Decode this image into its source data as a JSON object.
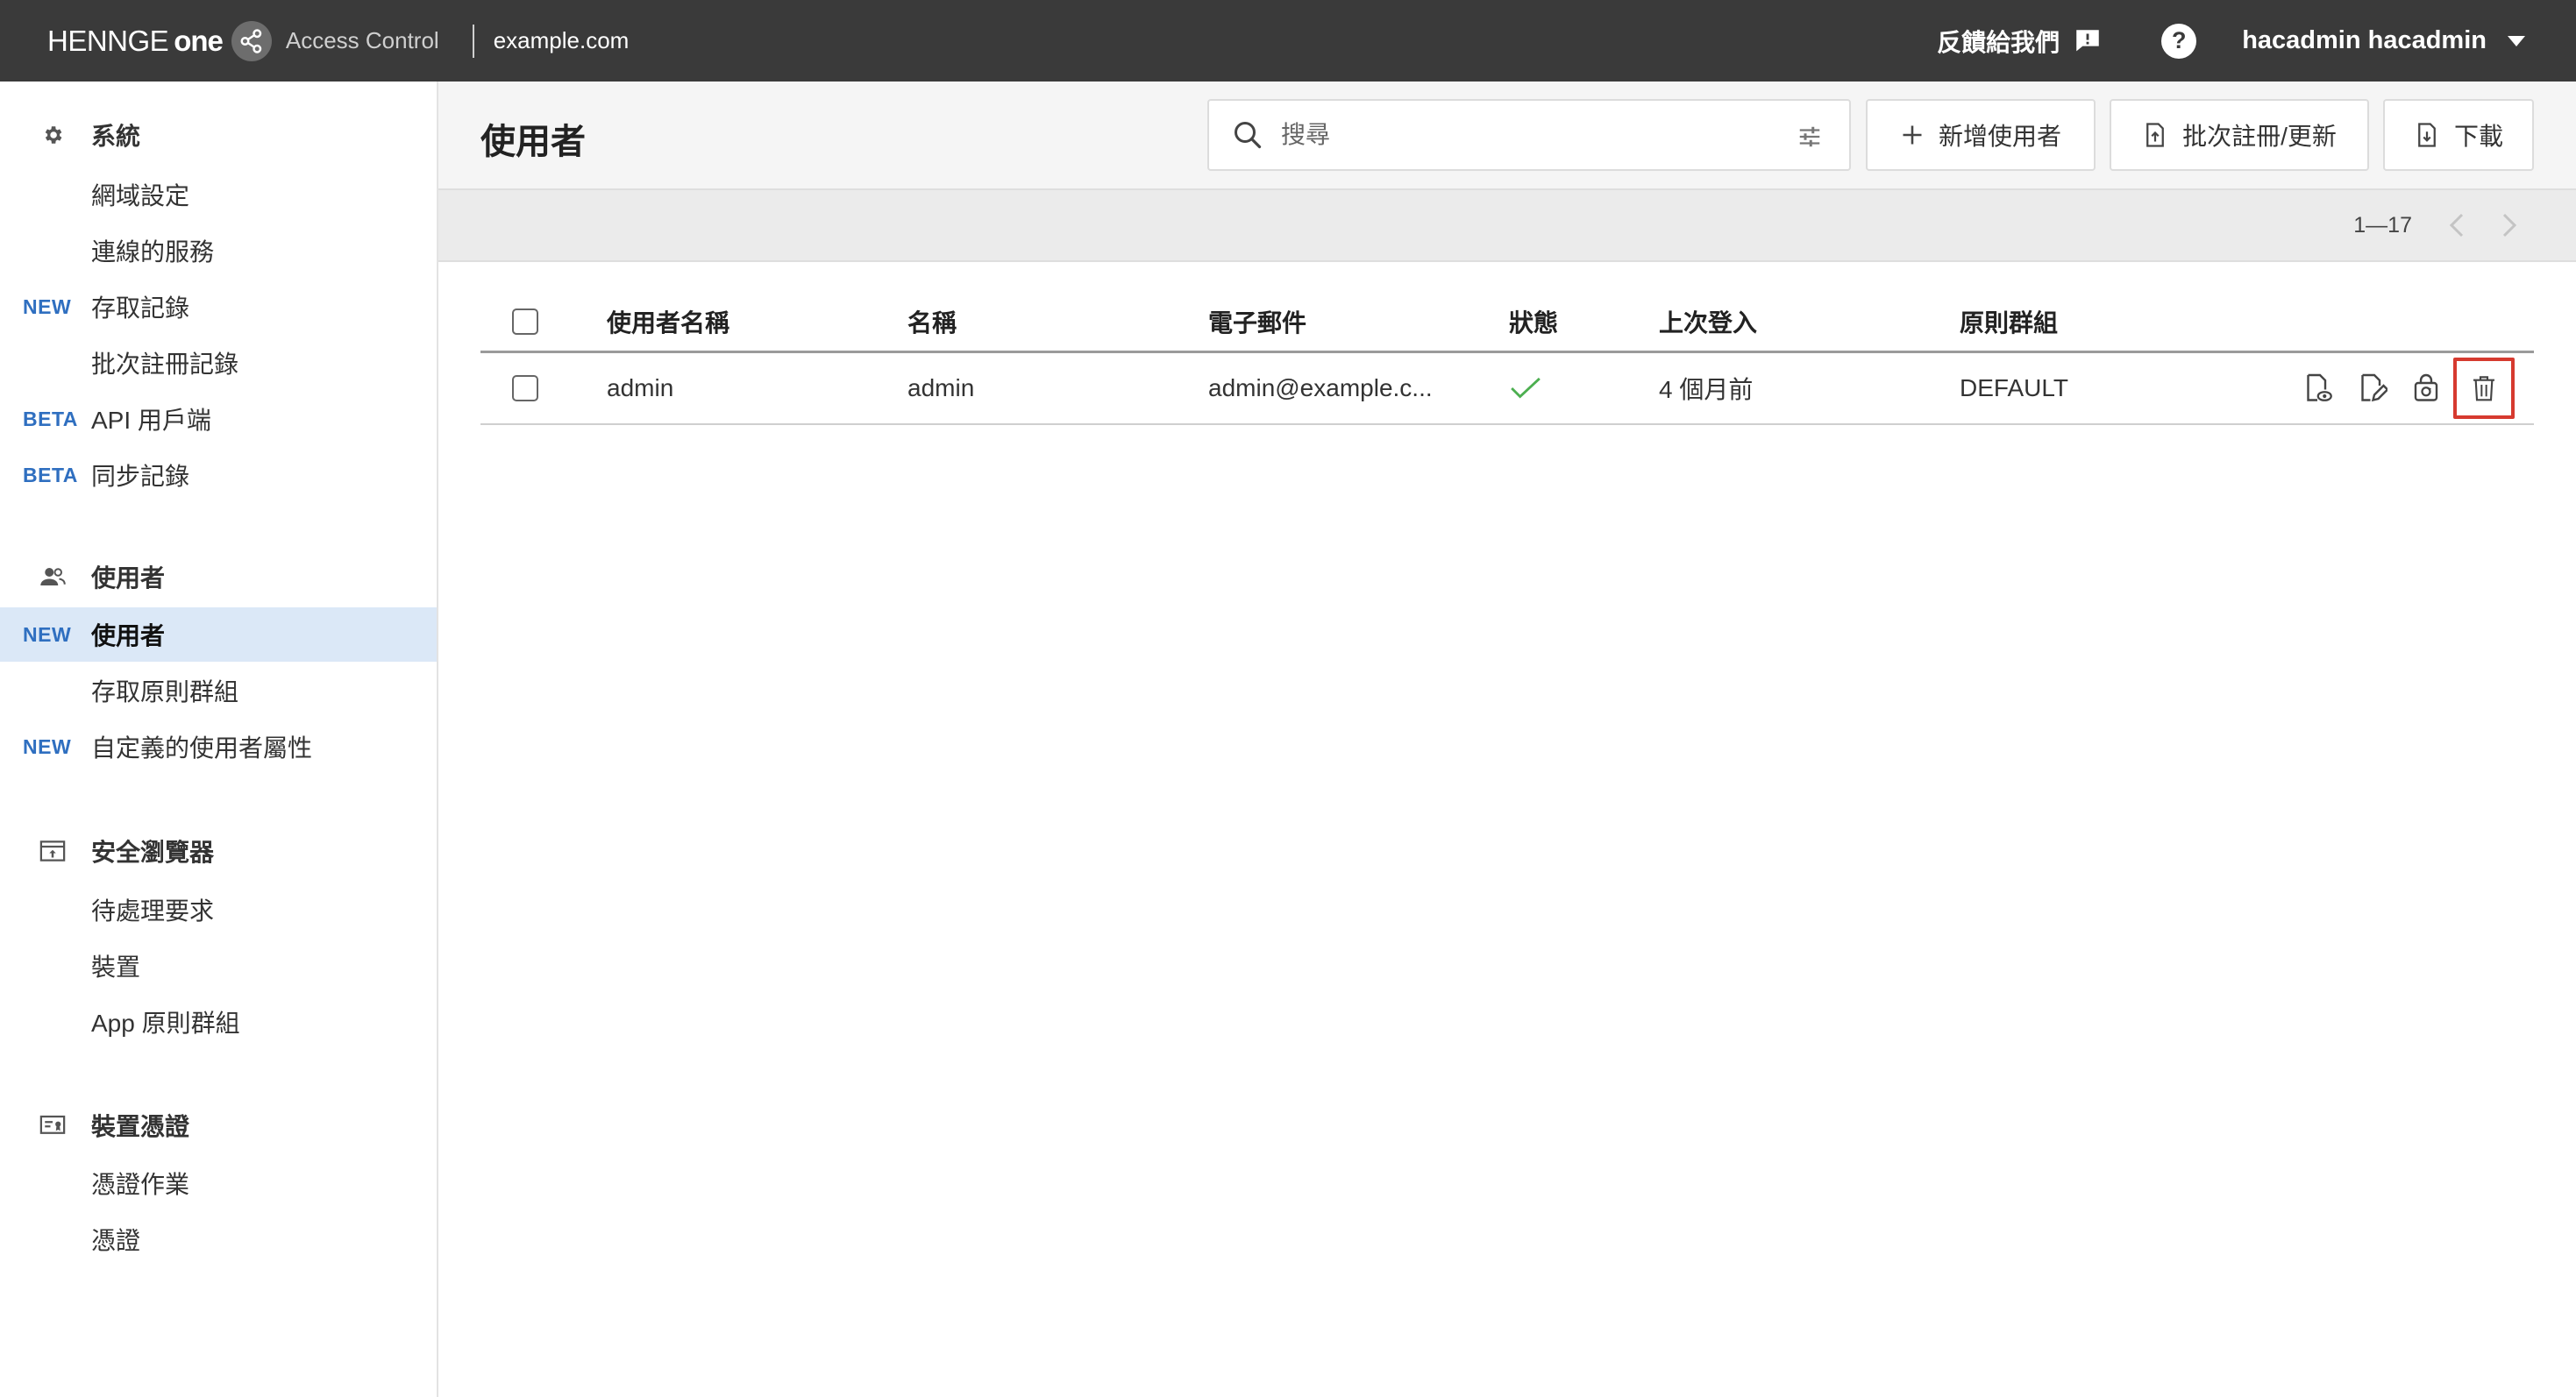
{
  "topbar": {
    "brand": "HENNGE",
    "brand_one": "one",
    "product": "Access Control",
    "domain": "example.com",
    "feedback_label": "反饋給我們",
    "help_label": "?",
    "user_name": "hacadmin hacadmin"
  },
  "sidebar": {
    "sections": [
      {
        "label": "系統",
        "icon": "gear-icon",
        "items": [
          {
            "tag": "",
            "label": "網域設定"
          },
          {
            "tag": "",
            "label": "連線的服務"
          },
          {
            "tag": "NEW",
            "label": "存取記錄"
          },
          {
            "tag": "",
            "label": "批次註冊記錄"
          },
          {
            "tag": "BETA",
            "label": "API 用戶端"
          },
          {
            "tag": "BETA",
            "label": "同步記錄"
          }
        ]
      },
      {
        "label": "使用者",
        "icon": "users-icon",
        "items": [
          {
            "tag": "NEW",
            "label": "使用者",
            "active": true
          },
          {
            "tag": "",
            "label": "存取原則群組"
          },
          {
            "tag": "NEW",
            "label": "自定義的使用者屬性"
          }
        ]
      },
      {
        "label": "安全瀏覽器",
        "icon": "browser-icon",
        "items": [
          {
            "tag": "",
            "label": "待處理要求"
          },
          {
            "tag": "",
            "label": "裝置"
          },
          {
            "tag": "",
            "label": "App 原則群組"
          }
        ]
      },
      {
        "label": "裝置憑證",
        "icon": "certificate-icon",
        "items": [
          {
            "tag": "",
            "label": "憑證作業"
          },
          {
            "tag": "",
            "label": "憑證"
          }
        ]
      }
    ]
  },
  "main": {
    "title": "使用者",
    "search_placeholder": "搜尋",
    "buttons": {
      "add_user": "新增使用者",
      "bulk": "批次註冊/更新",
      "download": "下載"
    },
    "pager": {
      "range": "1—17"
    },
    "table": {
      "columns": [
        "使用者名稱",
        "名稱",
        "電子郵件",
        "狀態",
        "上次登入",
        "原則群組"
      ],
      "rows": [
        {
          "username": "admin",
          "name": "admin",
          "email": "admin@example.c...",
          "status": "active",
          "last_login": "4 個月前",
          "policy_group": "DEFAULT"
        }
      ]
    }
  },
  "colors": {
    "topbar_bg": "#3a3a3a",
    "tag_blue": "#2f6fc0",
    "active_bg": "#dbe8f7",
    "status_ok": "#4caf50",
    "highlight_red": "#d63a2f"
  }
}
